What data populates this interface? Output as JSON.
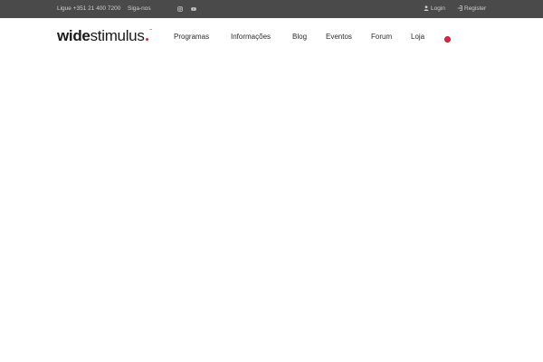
{
  "topbar": {
    "phone_text": "Ligue +351 21 400 7200",
    "follow_text": "Siga-nos",
    "login_label": "Login",
    "register_label": "Register"
  },
  "header": {
    "logo_bold": "wide",
    "logo_light": "stimulus",
    "nav": {
      "programas": "Programas",
      "informacoes": "Informações",
      "blog": "Blog",
      "eventos": "Eventos",
      "forum": "Forum",
      "loja": "Loja"
    }
  },
  "icons": {
    "instagram": "instagram-icon",
    "youtube": "youtube-icon",
    "user": "user-icon",
    "signin": "sign-in-icon",
    "cart": "cart-badge"
  },
  "colors": {
    "topbar_bg": "#4a4a4a",
    "topbar_text": "#cfcfcf",
    "accent": "#e4233d",
    "nav_text": "#2b2b2b"
  }
}
